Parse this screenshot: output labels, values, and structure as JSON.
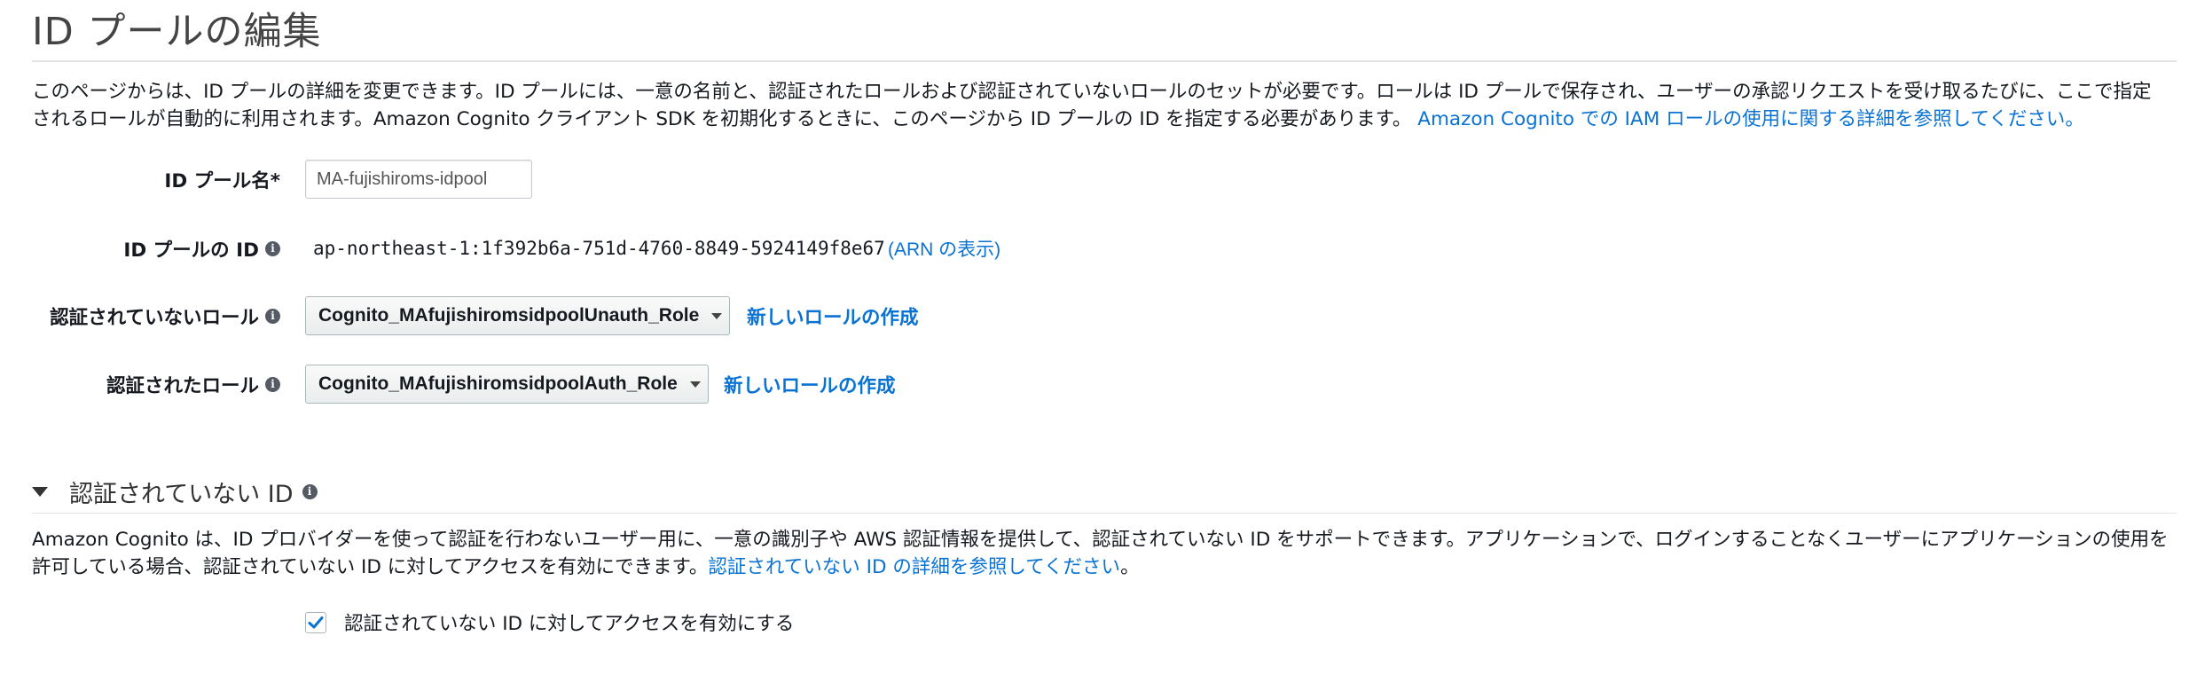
{
  "page": {
    "title": "ID プールの編集",
    "intro_text": "このページからは、ID プールの詳細を変更できます。ID プールには、一意の名前と、認証されたロールおよび認証されていないロールのセットが必要です。ロールは ID プールで保存され、ユーザーの承認リクエストを受け取るたびに、ここで指定されるロールが自動的に利用されます。Amazon Cognito クライアント SDK を初期化するときに、このページから ID プールの ID を指定する必要があります。",
    "intro_link": "Amazon Cognito での IAM ロールの使用に関する詳細を参照してください。"
  },
  "form": {
    "pool_name": {
      "label": "ID プール名*",
      "value": "MA-fujishiroms-idpool"
    },
    "pool_id": {
      "label": "ID プールの ID",
      "value": "ap-northeast-1:1f392b6a-751d-4760-8849-5924149f8e67",
      "arn_link": "(ARN の表示)"
    },
    "unauth_role": {
      "label": "認証されていないロール",
      "selected": "Cognito_MAfujishiromsidpoolUnauth_Role",
      "new_role_link": "新しいロールの作成"
    },
    "auth_role": {
      "label": "認証されたロール",
      "selected": "Cognito_MAfujishiromsidpoolAuth_Role",
      "new_role_link": "新しいロールの作成"
    }
  },
  "unauth_section": {
    "title": "認証されていない ID",
    "description": "Amazon Cognito は、ID プロバイダーを使って認証を行わないユーザー用に、一意の識別子や AWS 認証情報を提供して、認証されていない ID をサポートできます。アプリケーションで、ログインすることなくユーザーにアプリケーションの使用を許可している場合、認証されていない ID に対してアクセスを有効にできます。",
    "description_link": "認証されていない ID の詳細を参照してください",
    "description_end": "。",
    "checkbox_label": "認証されていない ID に対してアクセスを有効にする",
    "checkbox_checked": true
  },
  "icons": {
    "info": "info-icon",
    "check": "check-icon",
    "caret": "caret-down-icon",
    "collapse": "triangle-down-icon"
  },
  "colors": {
    "link": "#0972d3",
    "check": "#0972d3"
  }
}
